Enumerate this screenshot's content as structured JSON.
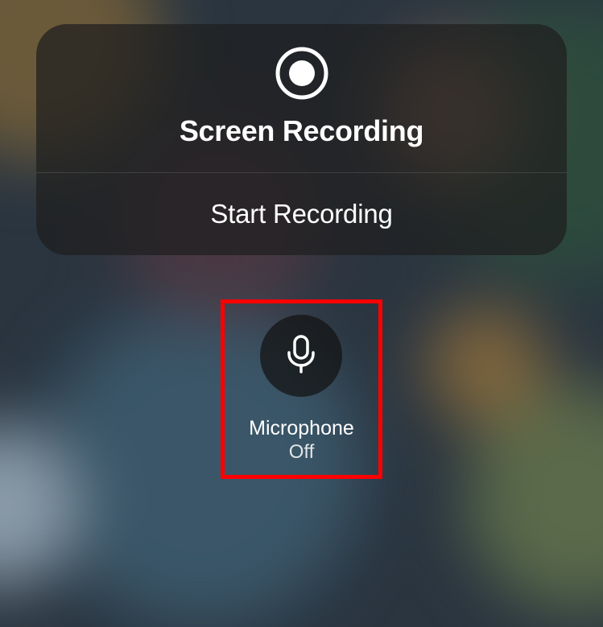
{
  "panel": {
    "title": "Screen Recording",
    "action_label": "Start Recording"
  },
  "microphone": {
    "label": "Microphone",
    "status": "Off"
  }
}
